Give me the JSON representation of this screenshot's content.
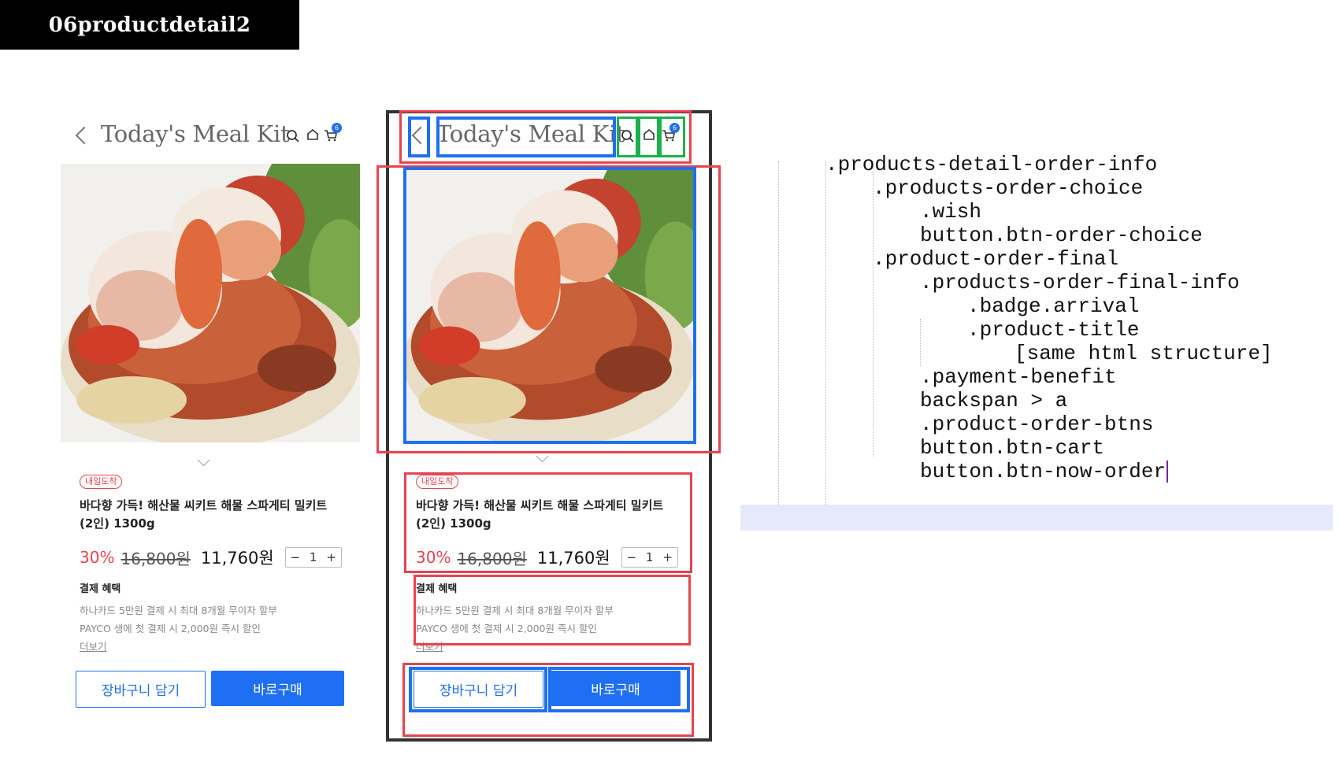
{
  "banner": {
    "title": "06productdetail2"
  },
  "header": {
    "title": "Today's Meal Kit",
    "cart_count": "6"
  },
  "product": {
    "badge": "내일도착",
    "title_line1": "바다향 가득! 해산물 씨키트 해물 스파게티 밀키트",
    "title_line2": "(2인) 1300g",
    "discount": "30%",
    "original_price": "16,800원",
    "final_price": "11,760원",
    "quantity": "1",
    "minus": "−",
    "plus": "+"
  },
  "benefit": {
    "title": "결제 혜택",
    "line1": "하나카드 5만원 결제 시 최대 8개월 무이자 할부",
    "line2": "PAYCO 생에 첫 결제 시 2,000원 즉시 할인",
    "more": "더보기"
  },
  "buttons": {
    "cart": "장바구니 담기",
    "now": "바로구매"
  },
  "code": {
    "lines": [
      ".products-detail-order-info",
      ".products-order-choice",
      ".wish",
      "button.btn-order-choice",
      ".product-order-final",
      ".products-order-final-info",
      ".badge.arrival",
      ".product-title",
      "[same html structure]",
      ".payment-benefit",
      "backspan > a",
      ".product-order-btns",
      "button.btn-cart",
      "button.btn-now-order"
    ]
  },
  "colors": {
    "accent": "#1f6ff2",
    "sale": "#e8434f",
    "annotation_red": "#e8434f",
    "annotation_blue": "#1f6ff2",
    "annotation_green": "#1ab24b"
  },
  "icons": [
    "chevron-left-icon",
    "search-icon",
    "home-icon",
    "cart-icon",
    "chevron-down-icon",
    "caret-icon"
  ]
}
